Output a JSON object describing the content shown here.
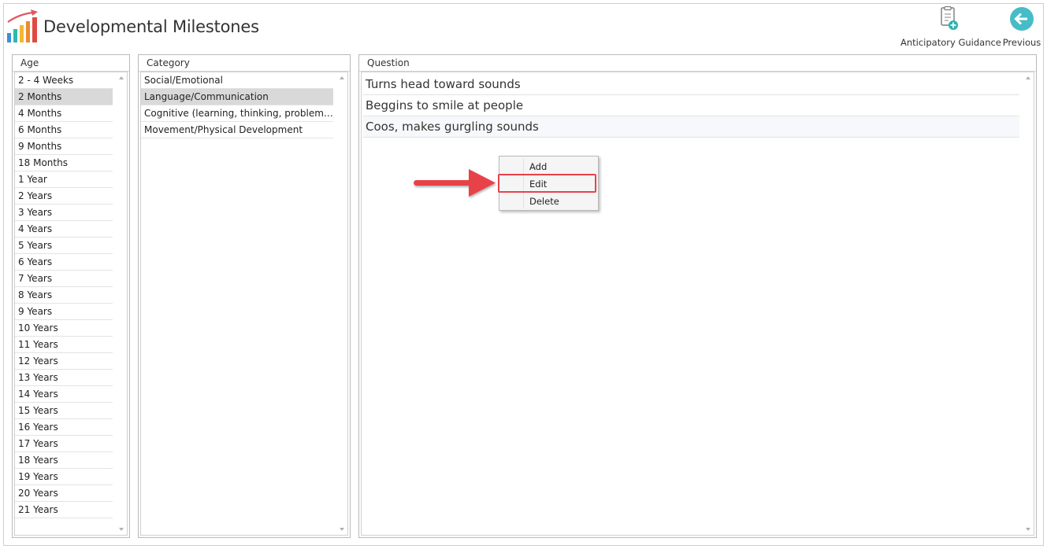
{
  "header": {
    "title": "Developmental Milestones",
    "anticipatory_label": "Anticipatory Guidance",
    "previous_label": "Previous"
  },
  "age_panel": {
    "title": "Age",
    "items": [
      "2 - 4 Weeks",
      "2 Months",
      "4 Months",
      "6 Months",
      "9 Months",
      "18 Months",
      "1 Year",
      "2 Years",
      "3 Years",
      "4 Years",
      "5 Years",
      "6 Years",
      "7 Years",
      "8 Years",
      "9 Years",
      "10 Years",
      "11 Years",
      "12 Years",
      "13 Years",
      "14 Years",
      "15 Years",
      "16 Years",
      "17 Years",
      "18 Years",
      "19 Years",
      "20 Years",
      "21 Years"
    ],
    "selected": "2 Months"
  },
  "category_panel": {
    "title": "Category",
    "items": [
      "Social/Emotional",
      "Language/Communication",
      "Cognitive (learning, thinking, problem-solvi...",
      "Movement/Physical Development"
    ],
    "selected": "Language/Communication"
  },
  "question_panel": {
    "title": "Question",
    "items": [
      "Turns head toward sounds",
      "Beggins to smile at people",
      "Coos, makes gurgling sounds"
    ]
  },
  "context_menu": {
    "items": [
      "Add",
      "Edit",
      "Delete"
    ],
    "highlighted": "Edit"
  },
  "colors": {
    "annotation_red": "#e8424a",
    "selection_gray": "#d9d9d9",
    "back_button_teal": "#45bcc7"
  }
}
